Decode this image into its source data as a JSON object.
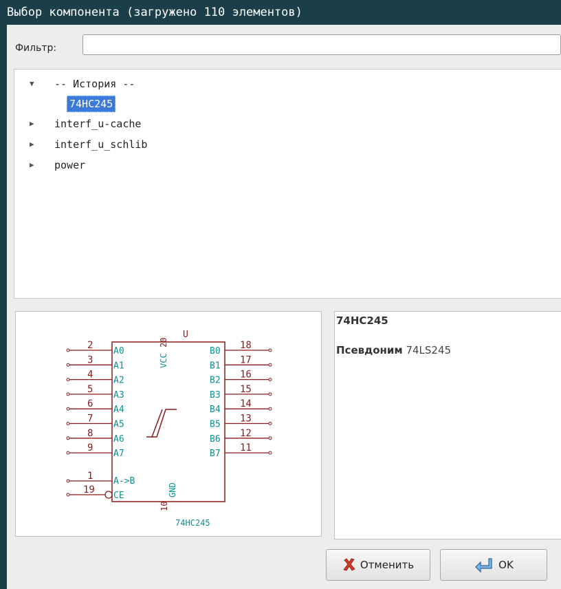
{
  "window": {
    "title": "Выбор компонента (загружено 110 элементов)"
  },
  "filter": {
    "label": "Фильтр:",
    "value": "",
    "placeholder": ""
  },
  "tree": {
    "history_label": "-- История --",
    "history_item": "74HC245",
    "libraries": [
      "interf_u-cache",
      "interf_u_schlib",
      "power"
    ]
  },
  "schematic": {
    "reference": "U",
    "value": "74HC245",
    "vcc_label": "VCC",
    "vcc_pin": "20",
    "gnd_label": "GND",
    "gnd_pin": "10",
    "left_pins": [
      {
        "num": "2",
        "name": "A0"
      },
      {
        "num": "3",
        "name": "A1"
      },
      {
        "num": "4",
        "name": "A2"
      },
      {
        "num": "5",
        "name": "A3"
      },
      {
        "num": "6",
        "name": "A4"
      },
      {
        "num": "7",
        "name": "A5"
      },
      {
        "num": "8",
        "name": "A6"
      },
      {
        "num": "9",
        "name": "A7"
      }
    ],
    "right_pins": [
      {
        "num": "18",
        "name": "B0"
      },
      {
        "num": "17",
        "name": "B1"
      },
      {
        "num": "16",
        "name": "B2"
      },
      {
        "num": "15",
        "name": "B3"
      },
      {
        "num": "14",
        "name": "B4"
      },
      {
        "num": "13",
        "name": "B5"
      },
      {
        "num": "12",
        "name": "B6"
      },
      {
        "num": "11",
        "name": "B7"
      }
    ],
    "dir_pin": {
      "num": "1",
      "name": "A->B"
    },
    "ce_pin": {
      "num": "19",
      "name": "CE"
    },
    "colors": {
      "outline": "#8b1a1a",
      "pin_name": "#0f8f8f",
      "pin_number": "#8b1a1a"
    }
  },
  "info": {
    "title": "74HC245",
    "alias_label": "Псевдоним",
    "alias_value": "74LS245"
  },
  "buttons": {
    "cancel_label": "Отменить",
    "ok_label": "OK"
  }
}
